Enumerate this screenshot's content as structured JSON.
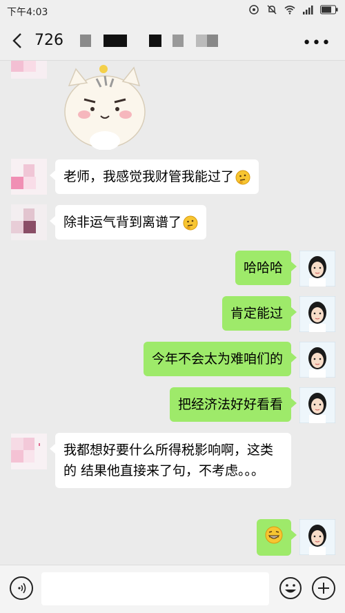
{
  "statusbar": {
    "time": "下午4:03"
  },
  "header": {
    "title": "726",
    "more_label": "•••"
  },
  "messages": [
    {
      "text": "老师，我感觉我财管我能过了"
    },
    {
      "text": "除非运气背到离谱了"
    },
    {
      "text": "哈哈哈"
    },
    {
      "text": "肯定能过"
    },
    {
      "text": "今年不会太为难咱们的"
    },
    {
      "text": "把经济法好好看看"
    },
    {
      "text": "我都想好要什么所得税影响啊，这类的 结果他直接来了句，不考虑。。。"
    }
  ],
  "colors": {
    "sent_bubble": "#9eea6a",
    "received_bubble": "#ffffff",
    "background": "#ebebeb"
  }
}
